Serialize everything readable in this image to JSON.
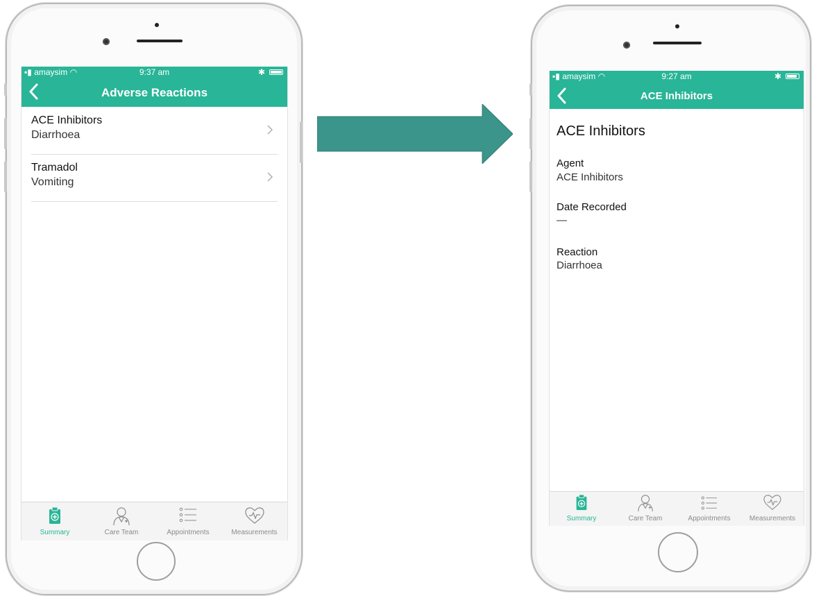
{
  "colors": {
    "accent": "#29b597",
    "arrow": "#3b958a"
  },
  "left_phone": {
    "status": {
      "carrier": "amaysim",
      "time": "9:37 am"
    },
    "nav": {
      "title": "Adverse Reactions"
    },
    "list": [
      {
        "title": "ACE Inhibitors",
        "subtitle": "Diarrhoea"
      },
      {
        "title": "Tramadol",
        "subtitle": "Vomiting"
      }
    ],
    "tabs": [
      {
        "label": "Summary",
        "icon": "clipboard-icon",
        "active": true
      },
      {
        "label": "Care Team",
        "icon": "doctor-icon",
        "active": false
      },
      {
        "label": "Appointments",
        "icon": "list-icon",
        "active": false
      },
      {
        "label": "Measurements",
        "icon": "heart-pulse-icon",
        "active": false
      }
    ]
  },
  "right_phone": {
    "status": {
      "carrier": "amaysim",
      "time": "9:27 am"
    },
    "nav": {
      "title": "ACE Inhibitors"
    },
    "detail": {
      "title": "ACE Inhibitors",
      "fields": [
        {
          "label": "Agent",
          "value": "ACE Inhibitors"
        },
        {
          "label": "Date Recorded",
          "value": "—"
        },
        {
          "label": "Reaction",
          "value": "Diarrhoea"
        }
      ]
    },
    "tabs": [
      {
        "label": "Summary",
        "icon": "clipboard-icon",
        "active": true
      },
      {
        "label": "Care Team",
        "icon": "doctor-icon",
        "active": false
      },
      {
        "label": "Appointments",
        "icon": "list-icon",
        "active": false
      },
      {
        "label": "Measurements",
        "icon": "heart-pulse-icon",
        "active": false
      }
    ]
  }
}
